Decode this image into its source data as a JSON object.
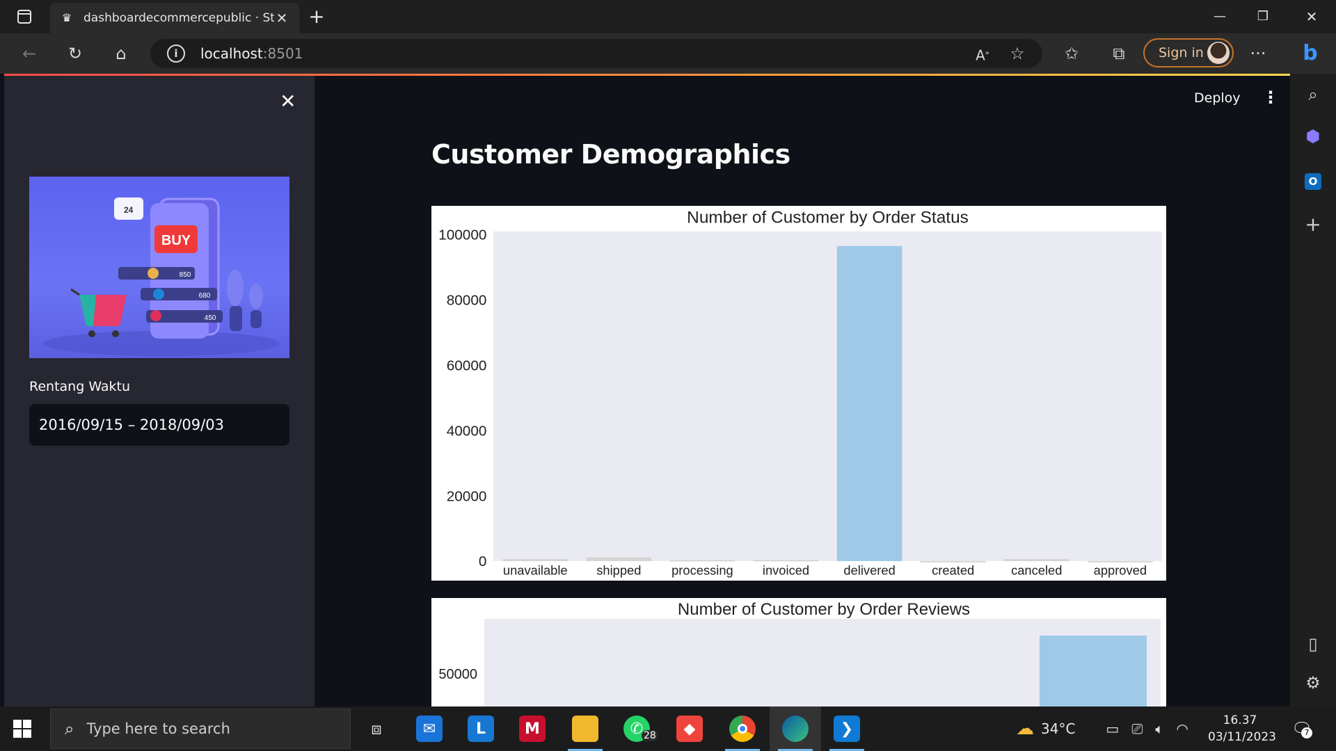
{
  "browser": {
    "tab_title": "dashboardecommercepublic · Str",
    "url_host": "localhost",
    "url_port": ":8501",
    "sign_in_label": "Sign in"
  },
  "app": {
    "deploy_label": "Deploy",
    "page_title": "Customer Demographics",
    "sidebar": {
      "date_label": "Rentang Waktu",
      "date_range": "2016/09/15 – 2018/09/03",
      "hero": {
        "buy_label": "BUY",
        "clock_badge": "24",
        "prices": [
          "850",
          "680",
          "450"
        ]
      }
    }
  },
  "chart_data": [
    {
      "type": "bar",
      "title": "Number of Customer by Order Status",
      "categories": [
        "unavailable",
        "shipped",
        "processing",
        "invoiced",
        "delivered",
        "created",
        "canceled",
        "approved"
      ],
      "values": [
        609,
        1107,
        301,
        314,
        96478,
        5,
        625,
        2
      ],
      "colors": [
        "#d3d3d3",
        "#d3d3d3",
        "#d3d3d3",
        "#d3d3d3",
        "#9ecae8",
        "#d3d3d3",
        "#d3d3d3",
        "#d3d3d3"
      ],
      "yticks": [
        0,
        20000,
        40000,
        60000,
        80000,
        100000
      ],
      "ylim": [
        0,
        101000
      ],
      "grid": false,
      "background": "#eaeaf2"
    },
    {
      "type": "bar",
      "title": "Number of Customer by Order Reviews",
      "yticks": [
        50000
      ],
      "bar_color": "#9ecae8",
      "background": "#eaeaf2",
      "note": ""
    }
  ],
  "taskbar": {
    "search_placeholder": "Type here to search",
    "whatsapp_badge": "28",
    "weather_temp": "34°C",
    "time": "16.37",
    "date": "03/11/2023",
    "notification_count": "7"
  }
}
